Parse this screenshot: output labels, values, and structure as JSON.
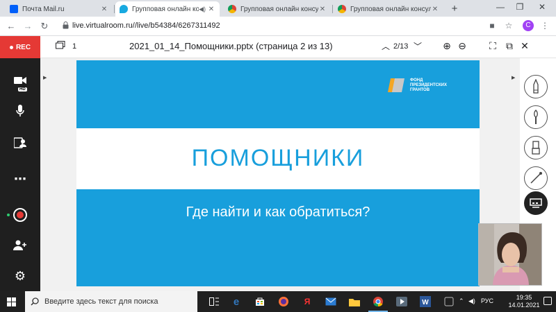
{
  "browser": {
    "tabs": [
      {
        "title": "Почта Mail.ru",
        "favicon_color": "#005ff9",
        "active": false
      },
      {
        "title": "Групповая онлайн конс",
        "favicon_color": "#18a9e0",
        "active": true
      },
      {
        "title": "Групповая онлайн консуль",
        "favicon_color": "#f4b400",
        "active": false
      },
      {
        "title": "Групповая онлайн консуль",
        "favicon_color": "#f4b400",
        "active": false
      }
    ],
    "new_tab": "+",
    "url": "live.virtualroom.ru//live/b54384/6267311492",
    "profile_initial": "C"
  },
  "app": {
    "rec_label": "REC",
    "hd_badge": "HD",
    "sidebar_icons": [
      "camera-icon",
      "mic-icon",
      "share-screen-icon",
      "more-icon",
      "record-icon",
      "add-user-icon",
      "settings-icon"
    ]
  },
  "document": {
    "page_indicator": "1",
    "title": "2021_01_14_Помощники.pptx (страница 2 из 13)",
    "pager": "2/13",
    "slide": {
      "title": "ПОМОЩНИКИ",
      "subtitle": "Где найти и как обратиться?",
      "logo_lines": [
        "ФОНД",
        "ПРЕЗИДЕНТСКИХ",
        "ГРАНТОВ"
      ]
    }
  },
  "tools": [
    "pen-tool",
    "brush-tool",
    "marker-tool",
    "line-tool",
    "presentation-tool"
  ],
  "taskbar": {
    "search_placeholder": "Введите здесь текст для поиска",
    "lang": "РУС",
    "time": "19:35",
    "date": "14.01.2021"
  }
}
